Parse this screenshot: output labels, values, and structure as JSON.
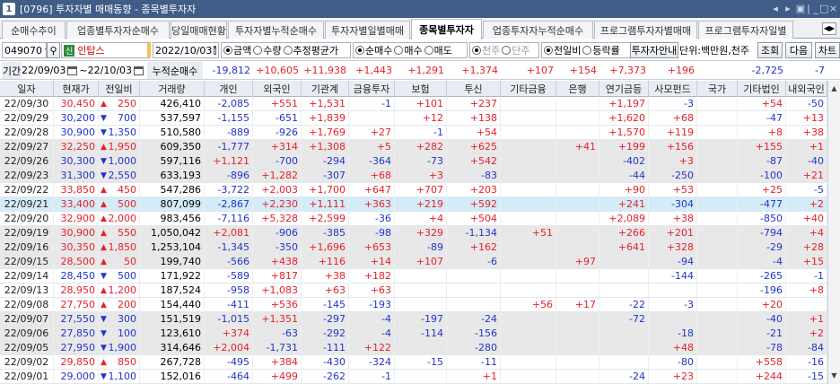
{
  "window": {
    "number": "1",
    "title": "[0796] 투자자별 매매동향 - 종목별투자자",
    "controls": [
      "◂",
      "▸",
      "▣",
      "|",
      "_",
      "□",
      "×"
    ]
  },
  "tabs": [
    {
      "label": "순매수추이",
      "active": false
    },
    {
      "label": "업종별투자자순매수",
      "active": false
    },
    {
      "label": "당일매매현황",
      "active": false
    },
    {
      "label": "투자자별누적순매수",
      "active": false
    },
    {
      "label": "투자자별일별매매",
      "active": false
    },
    {
      "label": "종목별투자자",
      "active": true
    },
    {
      "label": "업종투자자누적순매수",
      "active": false
    },
    {
      "label": "프로그램투자자별매매",
      "active": false
    },
    {
      "label": "프로그램투자자일별",
      "active": false
    }
  ],
  "toolbar": {
    "code": "049070",
    "stock_badge": "신",
    "stock_name": "인탑스",
    "date": "2022/10/03",
    "radio_amount": "금액",
    "radio_qty": "수량",
    "radio_avg": "추정평균가",
    "radio_net": "순매수",
    "radio_buy": "매수",
    "radio_sell": "매도",
    "radio_thousand": "천주",
    "radio_unit": "단주",
    "radio_prevday": "전일비",
    "radio_rate": "등락률",
    "investor_btn": "투자자안내",
    "unit_text": "단위:백만원,천주",
    "search_btn": "조회",
    "next_btn": "다음",
    "chart_btn": "차트"
  },
  "period": {
    "label": "기간",
    "from": "22/09/03",
    "to": "22/10/03",
    "sum_label": "누적순매수"
  },
  "summary": [
    "-19,812",
    "+10,605",
    "+11,938",
    "+1,443",
    "+1,291",
    "+1,374",
    "+107",
    "+154",
    "+7,373",
    "+196",
    "",
    "-2,725",
    "-7"
  ],
  "columns": [
    "일자",
    "현재가",
    "전일비",
    "거래량",
    "개인",
    "외국인",
    "기관계",
    "금융투자",
    "보험",
    "투신",
    "기타금융",
    "은행",
    "연기금등",
    "사모펀드",
    "국가",
    "기타법인",
    "내외국인"
  ],
  "rows": [
    [
      "22/09/30",
      "30,450",
      "▲",
      "250",
      "426,410",
      "-2,085",
      "+551",
      "+1,531",
      "-1",
      "+101",
      "+237",
      "",
      "",
      "+1,197",
      "-3",
      "",
      "+54",
      "-50"
    ],
    [
      "22/09/29",
      "30,200",
      "▼",
      "700",
      "537,597",
      "-1,155",
      "-651",
      "+1,839",
      "",
      "+12",
      "+138",
      "",
      "",
      "+1,620",
      "+68",
      "",
      "-47",
      "+13"
    ],
    [
      "22/09/28",
      "30,900",
      "▼",
      "1,350",
      "510,580",
      "-889",
      "-926",
      "+1,769",
      "+27",
      "-1",
      "+54",
      "",
      "",
      "+1,570",
      "+119",
      "",
      "+8",
      "+38"
    ],
    [
      "22/09/27",
      "32,250",
      "▲",
      "1,950",
      "609,350",
      "-1,777",
      "+314",
      "+1,308",
      "+5",
      "+282",
      "+625",
      "",
      "+41",
      "+199",
      "+156",
      "",
      "+155",
      "+1"
    ],
    [
      "22/09/26",
      "30,300",
      "▼",
      "1,000",
      "597,116",
      "+1,121",
      "-700",
      "-294",
      "-364",
      "-73",
      "+542",
      "",
      "",
      "-402",
      "+3",
      "",
      "-87",
      "-40"
    ],
    [
      "22/09/23",
      "31,300",
      "▼",
      "2,550",
      "633,193",
      "-896",
      "+1,282",
      "-307",
      "+68",
      "+3",
      "-83",
      "",
      "",
      "-44",
      "-250",
      "",
      "-100",
      "+21"
    ],
    [
      "22/09/22",
      "33,850",
      "▲",
      "450",
      "547,286",
      "-3,722",
      "+2,003",
      "+1,700",
      "+647",
      "+707",
      "+203",
      "",
      "",
      "+90",
      "+53",
      "",
      "+25",
      "-5"
    ],
    [
      "22/09/21",
      "33,400",
      "▲",
      "500",
      "807,099",
      "-2,867",
      "+2,230",
      "+1,111",
      "+363",
      "+219",
      "+592",
      "",
      "",
      "+241",
      "-304",
      "",
      "-477",
      "+2"
    ],
    [
      "22/09/20",
      "32,900",
      "▲",
      "2,000",
      "983,456",
      "-7,116",
      "+5,328",
      "+2,599",
      "-36",
      "+4",
      "+504",
      "",
      "",
      "+2,089",
      "+38",
      "",
      "-850",
      "+40"
    ],
    [
      "22/09/19",
      "30,900",
      "▲",
      "550",
      "1,050,042",
      "+2,081",
      "-906",
      "-385",
      "-98",
      "+329",
      "-1,134",
      "+51",
      "",
      "+266",
      "+201",
      "",
      "-794",
      "+4"
    ],
    [
      "22/09/16",
      "30,350",
      "▲",
      "1,850",
      "1,253,104",
      "-1,345",
      "-350",
      "+1,696",
      "+653",
      "-89",
      "+162",
      "",
      "",
      "+641",
      "+328",
      "",
      "-29",
      "+28"
    ],
    [
      "22/09/15",
      "28,500",
      "▲",
      "50",
      "199,740",
      "-566",
      "+438",
      "+116",
      "+14",
      "+107",
      "-6",
      "",
      "+97",
      "",
      "-94",
      "",
      "-4",
      "+15"
    ],
    [
      "22/09/14",
      "28,450",
      "▼",
      "500",
      "171,922",
      "-589",
      "+817",
      "+38",
      "+182",
      "",
      "",
      "",
      "",
      "",
      "-144",
      "",
      "-265",
      "-1"
    ],
    [
      "22/09/13",
      "28,950",
      "▲",
      "1,200",
      "187,524",
      "-958",
      "+1,083",
      "+63",
      "+63",
      "",
      "",
      "",
      "",
      "",
      "",
      "",
      "-196",
      "+8"
    ],
    [
      "22/09/08",
      "27,750",
      "▲",
      "200",
      "154,440",
      "-411",
      "+536",
      "-145",
      "-193",
      "",
      "",
      "+56",
      "+17",
      "-22",
      "-3",
      "",
      "+20",
      ""
    ],
    [
      "22/09/07",
      "27,550",
      "▼",
      "300",
      "151,519",
      "-1,015",
      "+1,351",
      "-297",
      "-4",
      "-197",
      "-24",
      "",
      "",
      "-72",
      "",
      "",
      "-40",
      "+1"
    ],
    [
      "22/09/06",
      "27,850",
      "▼",
      "100",
      "123,610",
      "+374",
      "-63",
      "-292",
      "-4",
      "-114",
      "-156",
      "",
      "",
      "",
      "-18",
      "",
      "-21",
      "+2"
    ],
    [
      "22/09/05",
      "27,950",
      "▼",
      "1,900",
      "314,646",
      "+2,004",
      "-1,731",
      "-111",
      "+122",
      "",
      "-280",
      "",
      "",
      "",
      "+48",
      "",
      "-78",
      "-84"
    ],
    [
      "22/09/02",
      "29,850",
      "▲",
      "850",
      "267,728",
      "-495",
      "+384",
      "-430",
      "-324",
      "-15",
      "-11",
      "",
      "",
      "",
      "-80",
      "",
      "+558",
      "-16"
    ],
    [
      "22/09/01",
      "29,000",
      "▼",
      "1,100",
      "152,016",
      "-464",
      "+499",
      "-262",
      "-1",
      "",
      "+1",
      "",
      "",
      "-24",
      "+23",
      "",
      "+244",
      "-15"
    ]
  ],
  "colors": {
    "positive": "#e8202a",
    "negative": "#2233cc",
    "title_bar": "#3f5d87",
    "grey_band": "#e8e8e8",
    "selected_row": "#d3ecf7"
  }
}
